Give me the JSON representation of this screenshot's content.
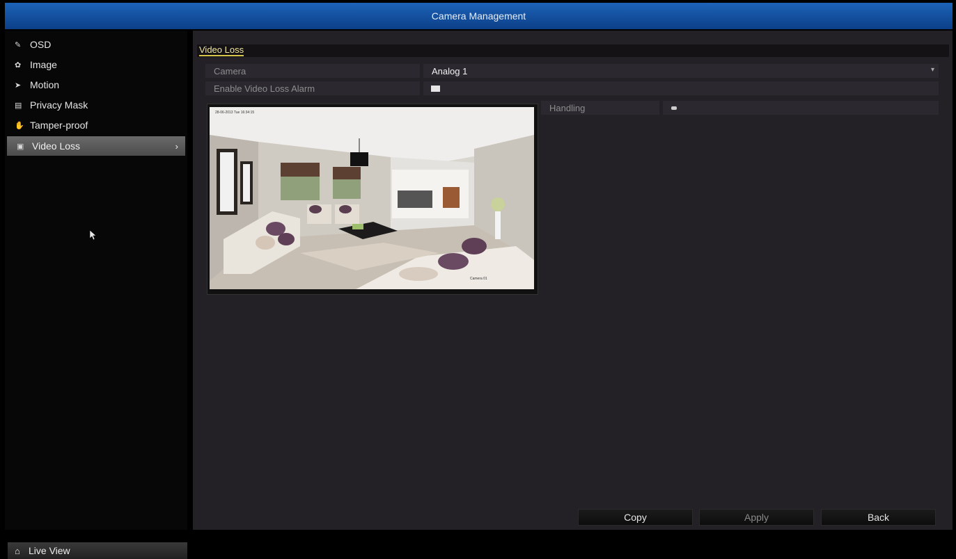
{
  "window": {
    "title": "Camera Management"
  },
  "sidebar": {
    "items": [
      {
        "label": "OSD",
        "icon": "osd-icon"
      },
      {
        "label": "Image",
        "icon": "image-icon"
      },
      {
        "label": "Motion",
        "icon": "motion-icon"
      },
      {
        "label": "Privacy Mask",
        "icon": "privacy-mask-icon"
      },
      {
        "label": "Tamper-proof",
        "icon": "tamper-proof-icon"
      },
      {
        "label": "Video Loss",
        "icon": "video-loss-icon",
        "active": true
      }
    ],
    "live_view": "Live View"
  },
  "main": {
    "section_title": "Video Loss",
    "camera": {
      "label": "Camera",
      "value": "Analog 1"
    },
    "enable_alarm": {
      "label": "Enable Video Loss Alarm",
      "checked": true
    },
    "handling": {
      "label": "Handling"
    },
    "preview": {
      "osd_datetime": "28-06-2013 Tue 16:34:15",
      "osd_camera_name": "Camera 01"
    }
  },
  "buttons": {
    "copy": "Copy",
    "apply": "Apply",
    "back": "Back"
  },
  "colors": {
    "title_bar": "#0c3f88",
    "accent": "#d7c54a",
    "panel": "#232026"
  }
}
